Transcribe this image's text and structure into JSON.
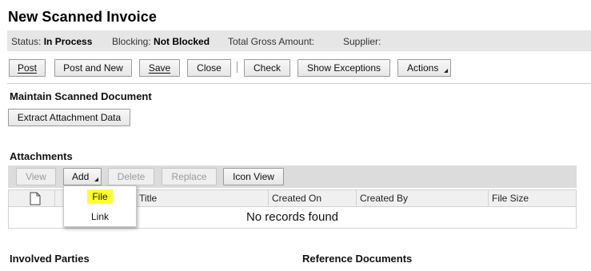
{
  "page": {
    "title": "New Scanned Invoice"
  },
  "status_bar": {
    "status_label": "Status:",
    "status_value": "In Process",
    "blocking_label": "Blocking:",
    "blocking_value": "Not Blocked",
    "gross_label": "Total Gross Amount:",
    "supplier_label": "Supplier:"
  },
  "toolbar": {
    "post": "Post",
    "post_and_new": "Post and New",
    "save": "Save",
    "close": "Close",
    "check": "Check",
    "show_exceptions": "Show Exceptions",
    "actions": "Actions"
  },
  "maintain": {
    "heading": "Maintain Scanned Document",
    "extract_button": "Extract Attachment Data"
  },
  "attachments": {
    "heading": "Attachments",
    "toolbar": {
      "view": "View",
      "add": "Add",
      "delete": "Delete",
      "replace": "Replace",
      "icon_view": "Icon View"
    },
    "columns": {
      "title": "Title",
      "created_on": "Created On",
      "created_by": "Created By",
      "file_size": "File Size"
    },
    "empty_text": "No records found",
    "add_menu": {
      "file": "File",
      "link": "Link",
      "highlight_color": "#ffff33"
    }
  },
  "sections": {
    "involved_parties": "Involved Parties",
    "reference_documents": "Reference Documents"
  }
}
